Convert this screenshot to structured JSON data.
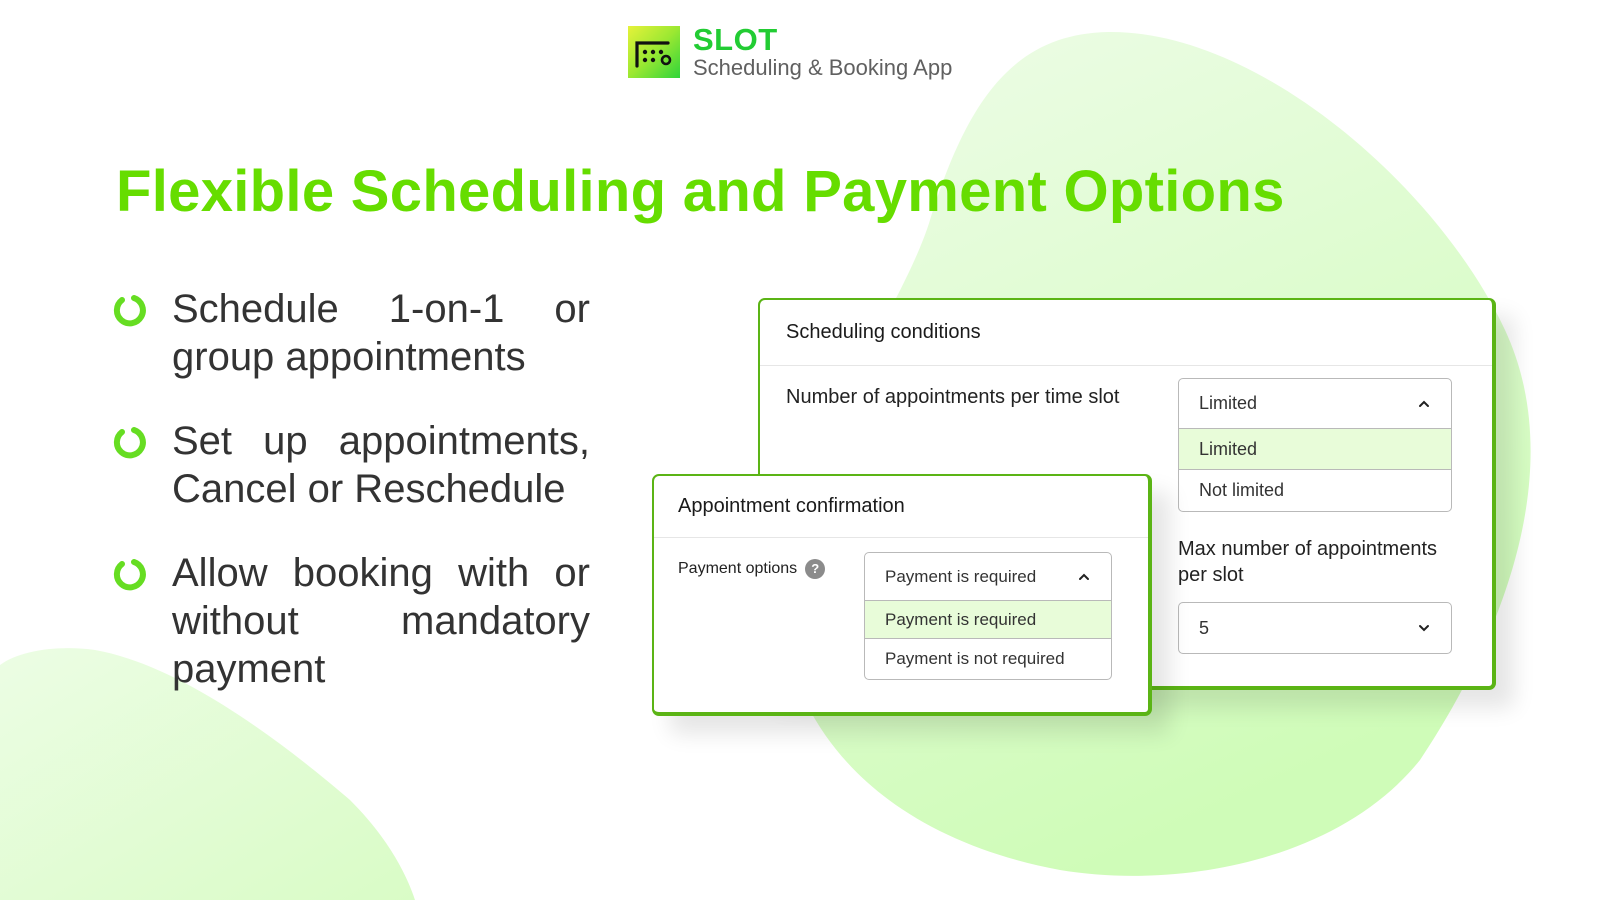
{
  "brand": {
    "name": "SLOT",
    "subtitle": "Scheduling & Booking App",
    "logo_icon": "calendar-slot-icon"
  },
  "page_title": "Flexible Scheduling and Payment Options",
  "features": [
    {
      "icon": "ring-bullet-icon",
      "text": "Schedule 1-on-1 or group appointments"
    },
    {
      "icon": "ring-bullet-icon",
      "text": "Set up appointments, Cancel or Reschedule"
    },
    {
      "icon": "ring-bullet-icon",
      "text": "Allow booking with or without mandatory payment"
    }
  ],
  "scheduling_card": {
    "title": "Scheduling conditions",
    "appointments_per_slot": {
      "label": "Number of appointments per time slot",
      "selected": "Limited",
      "options": [
        "Limited",
        "Not limited"
      ],
      "highlighted": "Limited",
      "expanded": true
    },
    "max_per_slot": {
      "label": "Max number of appointments per slot",
      "selected": "5",
      "expanded": false
    }
  },
  "confirmation_card": {
    "title": "Appointment confirmation",
    "payment_options": {
      "label": "Payment options",
      "help_icon": "?",
      "selected": "Payment is required",
      "options": [
        "Payment is required",
        "Payment is not required"
      ],
      "highlighted": "Payment is required",
      "expanded": true
    }
  },
  "colors": {
    "brand_green": "#22cc33",
    "title_green": "#66dd00",
    "card_border": "#5bb415",
    "option_highlight": "#e8fcd9",
    "blob_light": "#e8fbe0",
    "blob_mid": "#d2fcbc"
  }
}
